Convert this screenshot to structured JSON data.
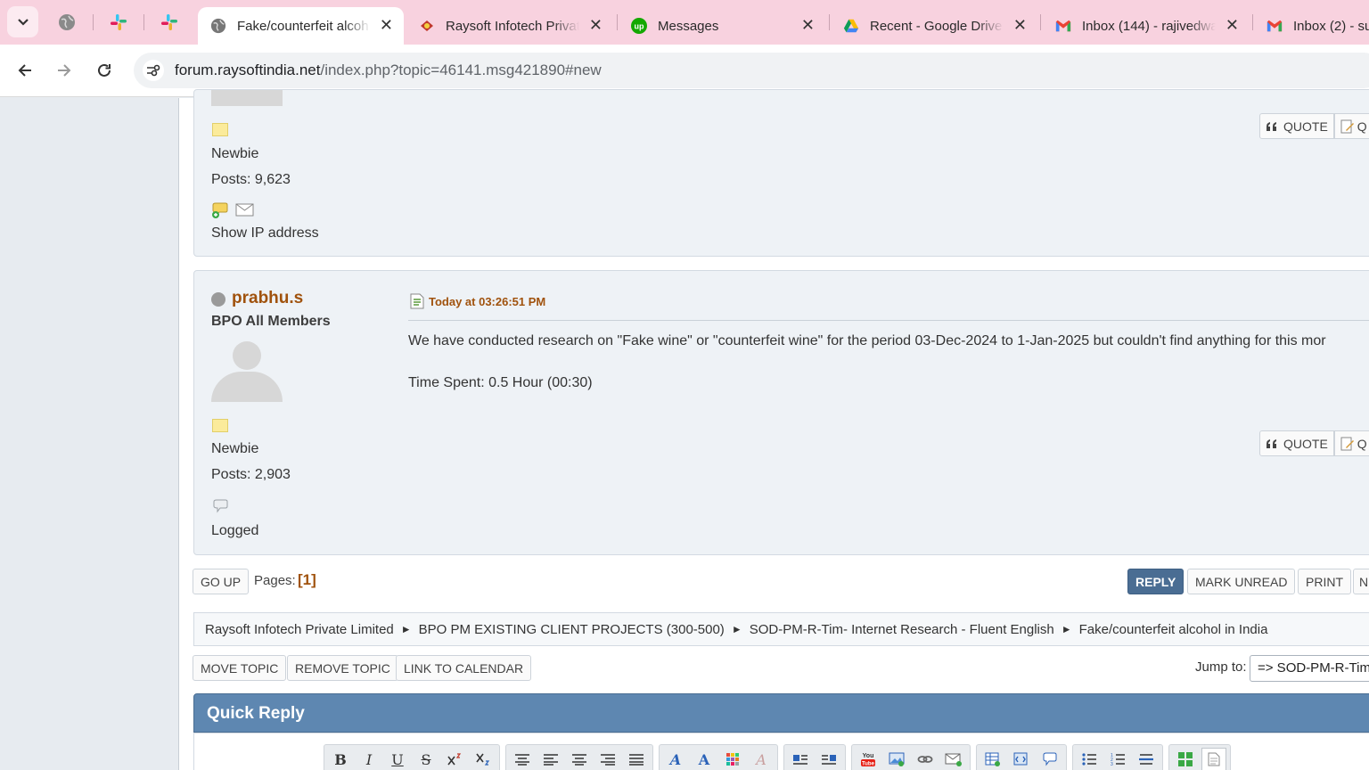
{
  "browser": {
    "tabs": [
      {
        "title": "Fake/counterfeit alcoh",
        "icon": "globe-icon",
        "active": true
      },
      {
        "title": "Raysoft Infotech Privat",
        "icon": "raysoft-icon",
        "active": false
      },
      {
        "title": "Messages",
        "icon": "upwork-icon",
        "active": false
      },
      {
        "title": "Recent - Google Drive",
        "icon": "google-drive-icon",
        "active": false
      },
      {
        "title": "Inbox (144) - rajivedwa",
        "icon": "gmail-icon",
        "active": false
      },
      {
        "title": "Inbox (2) - su",
        "icon": "gmail-icon",
        "active": false
      }
    ],
    "close_glyph": "✕",
    "url_host": "forum.raysoftindia.net",
    "url_path": "/index.php?topic=46141.msg421890#new"
  },
  "post1": {
    "rank": "Newbie",
    "posts": "Posts: 9,623",
    "show_ip": "Show IP address",
    "quote_label": "QUOTE",
    "quote2_label": "Q"
  },
  "post2": {
    "username": "prabhu.s",
    "group": "BPO All Members",
    "rank": "Newbie",
    "posts": "Posts: 2,903",
    "logged": "Logged",
    "date": "Today at 03:26:51 PM",
    "body_line1": "We have conducted research on \"Fake wine\" or \"counterfeit wine\" for the period 03-Dec-2024 to 1-Jan-2025 but couldn't find anything for this mor",
    "body_line2": "Time Spent: 0.5 Hour (00:30)",
    "quote_label": "QUOTE",
    "quote2_label": "Q"
  },
  "pagination": {
    "go_up": "GO UP",
    "pages_label": "Pages:",
    "pages_value": "[1]",
    "reply": "REPLY",
    "mark_unread": "MARK UNREAD",
    "print": "PRINT",
    "next_partial": "N"
  },
  "breadcrumb": {
    "items": [
      "Raysoft Infotech Private Limited",
      "BPO PM EXISTING CLIENT PROJECTS (300-500)",
      "SOD-PM-R-Tim- Internet Research - Fluent English",
      "Fake/counterfeit alcohol in India"
    ],
    "separator": "►"
  },
  "moderation": {
    "move_topic": "MOVE TOPIC",
    "remove_topic": "REMOVE TOPIC",
    "link_calendar": "LINK TO CALENDAR",
    "jump_label": "Jump to:",
    "jump_value": "=> SOD-PM-R-Tim"
  },
  "quick_reply": {
    "title": "Quick Reply"
  },
  "colors": {
    "accent_brown": "#a0520d",
    "header_blue": "#5e87b1",
    "reply_button": "#4a6d93",
    "tab_strip": "#f8d2df"
  }
}
